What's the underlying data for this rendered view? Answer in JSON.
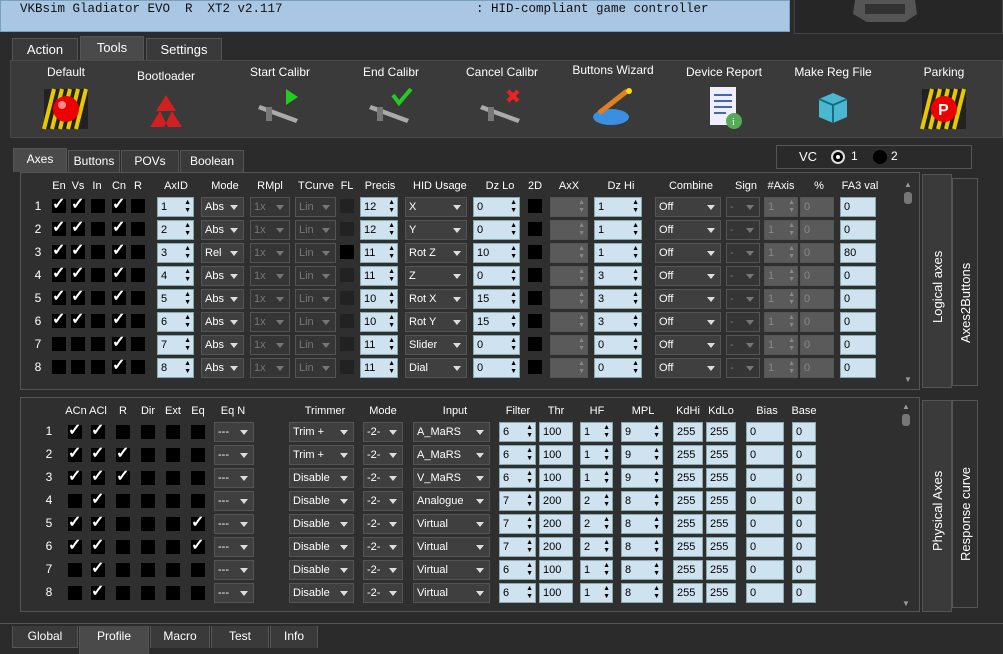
{
  "title": {
    "app": "VKBsim Gladiator EVO  R  XT2 v2.117",
    "device": ": HID-compliant game controller"
  },
  "main_tabs": [
    {
      "label": "Action"
    },
    {
      "label": "Tools"
    },
    {
      "label": "Settings"
    }
  ],
  "tools": [
    {
      "label": "Default",
      "icon": "red-alarm-icon"
    },
    {
      "label": "Bootloader",
      "icon": "recycle-icon"
    },
    {
      "label": "Start Calibr",
      "icon": "caliper-play-icon"
    },
    {
      "label": "End Calibr",
      "icon": "caliper-check-icon"
    },
    {
      "label": "Cancel Calibr",
      "icon": "caliper-cancel-icon"
    },
    {
      "label": "Buttons Wizard",
      "icon": "wizard-icon"
    },
    {
      "label": "Device Report",
      "icon": "report-icon"
    },
    {
      "label": "Make Reg File",
      "icon": "registry-icon"
    },
    {
      "label": "Parking",
      "icon": "parking-icon"
    }
  ],
  "sub_tabs": [
    {
      "label": "Axes"
    },
    {
      "label": "Buttons"
    },
    {
      "label": "POVs"
    },
    {
      "label": "Boolean"
    }
  ],
  "vc": {
    "label": "VC",
    "opt1": "1",
    "opt2": "2",
    "selected": "1"
  },
  "logical": {
    "side_labels": [
      "Logical axes",
      "Axes2Buttons"
    ],
    "headers": {
      "en": "En",
      "vs": "Vs",
      "in": "In",
      "cn": "Cn",
      "r": "R",
      "axid": "AxID",
      "mode": "Mode",
      "rmpl": "RMpl",
      "tcurve": "TCurve",
      "fl": "FL",
      "precis": "Precis",
      "hid": "HID Usage",
      "dzlo": "Dz Lo",
      "twod": "2D",
      "axx": "AxX",
      "dzhi": "Dz Hi",
      "combine": "Combine",
      "sign": "Sign",
      "naxis": "#Axis",
      "pct": "%",
      "fa3": "FA3 val"
    },
    "rows": [
      {
        "n": "1",
        "en": true,
        "vs": true,
        "in": false,
        "cn": true,
        "r": false,
        "axid": "1",
        "mode": "Abs",
        "rmpl": "1x",
        "tcurve": "Lin",
        "precis": "12",
        "hid": "X",
        "dzlo": "0",
        "dzhi": "1",
        "combine": "Off",
        "sign": "-",
        "naxis": "1",
        "pct": "0",
        "fa3": "0"
      },
      {
        "n": "2",
        "en": true,
        "vs": true,
        "in": false,
        "cn": true,
        "r": false,
        "axid": "2",
        "mode": "Abs",
        "rmpl": "1x",
        "tcurve": "Lin",
        "precis": "12",
        "hid": "Y",
        "dzlo": "0",
        "dzhi": "1",
        "combine": "Off",
        "sign": "-",
        "naxis": "1",
        "pct": "0",
        "fa3": "0"
      },
      {
        "n": "3",
        "en": true,
        "vs": true,
        "in": false,
        "cn": true,
        "r": false,
        "axid": "3",
        "mode": "Rel",
        "rmpl": "1x",
        "tcurve": "Lin",
        "precis": "11",
        "hid": "Rot Z",
        "dzlo": "10",
        "dzhi": "1",
        "combine": "Off",
        "sign": "-",
        "naxis": "1",
        "pct": "0",
        "fa3": "80"
      },
      {
        "n": "4",
        "en": true,
        "vs": true,
        "in": false,
        "cn": true,
        "r": false,
        "axid": "4",
        "mode": "Abs",
        "rmpl": "1x",
        "tcurve": "Lin",
        "precis": "11",
        "hid": "Z",
        "dzlo": "0",
        "dzhi": "3",
        "combine": "Off",
        "sign": "-",
        "naxis": "1",
        "pct": "0",
        "fa3": "0"
      },
      {
        "n": "5",
        "en": true,
        "vs": true,
        "in": false,
        "cn": true,
        "r": false,
        "axid": "5",
        "mode": "Abs",
        "rmpl": "1x",
        "tcurve": "Lin",
        "precis": "10",
        "hid": "Rot X",
        "dzlo": "15",
        "dzhi": "3",
        "combine": "Off",
        "sign": "-",
        "naxis": "1",
        "pct": "0",
        "fa3": "0"
      },
      {
        "n": "6",
        "en": true,
        "vs": true,
        "in": false,
        "cn": true,
        "r": false,
        "axid": "6",
        "mode": "Abs",
        "rmpl": "1x",
        "tcurve": "Lin",
        "precis": "10",
        "hid": "Rot Y",
        "dzlo": "15",
        "dzhi": "3",
        "combine": "Off",
        "sign": "-",
        "naxis": "1",
        "pct": "0",
        "fa3": "0"
      },
      {
        "n": "7",
        "en": false,
        "vs": false,
        "in": false,
        "cn": true,
        "r": false,
        "axid": "7",
        "mode": "Abs",
        "rmpl": "1x",
        "tcurve": "Lin",
        "precis": "11",
        "hid": "Slider",
        "dzlo": "0",
        "dzhi": "0",
        "combine": "Off",
        "sign": "-",
        "naxis": "1",
        "pct": "0",
        "fa3": "0"
      },
      {
        "n": "8",
        "en": false,
        "vs": false,
        "in": false,
        "cn": true,
        "r": false,
        "axid": "8",
        "mode": "Abs",
        "rmpl": "1x",
        "tcurve": "Lin",
        "precis": "11",
        "hid": "Dial",
        "dzlo": "0",
        "dzhi": "0",
        "combine": "Off",
        "sign": "-",
        "naxis": "1",
        "pct": "0",
        "fa3": "0"
      }
    ]
  },
  "physical": {
    "side_labels": [
      "Physical Axes",
      "Response curve"
    ],
    "headers": {
      "acn": "ACn",
      "acl": "ACl",
      "r": "R",
      "dir": "Dir",
      "ext": "Ext",
      "eq": "Eq",
      "eqn": "Eq N",
      "trimmer": "Trimmer",
      "mode": "Mode",
      "input": "Input",
      "filter": "Filter",
      "thr": "Thr",
      "hf": "HF",
      "mpl": "MPL",
      "kdhi": "KdHi",
      "kdlo": "KdLo",
      "bias": "Bias",
      "base": "Base"
    },
    "rows": [
      {
        "n": "1",
        "acn": true,
        "acl": true,
        "r": false,
        "dir": false,
        "ext": false,
        "eq": false,
        "eqn": "---",
        "trimmer": "Trim +",
        "mode": "-2-",
        "input": "A_MaRS",
        "filter": "6",
        "thr": "100",
        "hf": "1",
        "mpl": "9",
        "kdhi": "255",
        "kdlo": "255",
        "bias": "0",
        "base": "0"
      },
      {
        "n": "2",
        "acn": true,
        "acl": true,
        "r": true,
        "dir": false,
        "ext": false,
        "eq": false,
        "eqn": "---",
        "trimmer": "Trim +",
        "mode": "-2-",
        "input": "A_MaRS",
        "filter": "6",
        "thr": "100",
        "hf": "1",
        "mpl": "9",
        "kdhi": "255",
        "kdlo": "255",
        "bias": "0",
        "base": "0"
      },
      {
        "n": "3",
        "acn": true,
        "acl": true,
        "r": true,
        "dir": false,
        "ext": false,
        "eq": false,
        "eqn": "---",
        "trimmer": "Disable",
        "mode": "-2-",
        "input": "V_MaRS",
        "filter": "6",
        "thr": "100",
        "hf": "1",
        "mpl": "9",
        "kdhi": "255",
        "kdlo": "255",
        "bias": "0",
        "base": "0"
      },
      {
        "n": "4",
        "acn": false,
        "acl": true,
        "r": false,
        "dir": false,
        "ext": false,
        "eq": false,
        "eqn": "---",
        "trimmer": "Disable",
        "mode": "-2-",
        "input": "Analogue",
        "filter": "7",
        "thr": "200",
        "hf": "2",
        "mpl": "8",
        "kdhi": "255",
        "kdlo": "255",
        "bias": "0",
        "base": "0"
      },
      {
        "n": "5",
        "acn": true,
        "acl": true,
        "r": false,
        "dir": false,
        "ext": false,
        "eq": true,
        "eqn": "---",
        "trimmer": "Disable",
        "mode": "-2-",
        "input": "Virtual",
        "filter": "7",
        "thr": "200",
        "hf": "2",
        "mpl": "8",
        "kdhi": "255",
        "kdlo": "255",
        "bias": "0",
        "base": "0"
      },
      {
        "n": "6",
        "acn": true,
        "acl": true,
        "r": false,
        "dir": false,
        "ext": false,
        "eq": true,
        "eqn": "---",
        "trimmer": "Disable",
        "mode": "-2-",
        "input": "Virtual",
        "filter": "7",
        "thr": "200",
        "hf": "2",
        "mpl": "8",
        "kdhi": "255",
        "kdlo": "255",
        "bias": "0",
        "base": "0"
      },
      {
        "n": "7",
        "acn": false,
        "acl": true,
        "r": false,
        "dir": false,
        "ext": false,
        "eq": false,
        "eqn": "---",
        "trimmer": "Disable",
        "mode": "-2-",
        "input": "Virtual",
        "filter": "6",
        "thr": "100",
        "hf": "1",
        "mpl": "8",
        "kdhi": "255",
        "kdlo": "255",
        "bias": "0",
        "base": "0"
      },
      {
        "n": "8",
        "acn": false,
        "acl": true,
        "r": false,
        "dir": false,
        "ext": false,
        "eq": false,
        "eqn": "---",
        "trimmer": "Disable",
        "mode": "-2-",
        "input": "Virtual",
        "filter": "6",
        "thr": "100",
        "hf": "1",
        "mpl": "8",
        "kdhi": "255",
        "kdlo": "255",
        "bias": "0",
        "base": "0"
      }
    ]
  },
  "bottom_tabs": [
    {
      "label": "Global"
    },
    {
      "label": "Profile"
    },
    {
      "label": "Macro"
    },
    {
      "label": "Test"
    },
    {
      "label": "Info"
    }
  ]
}
